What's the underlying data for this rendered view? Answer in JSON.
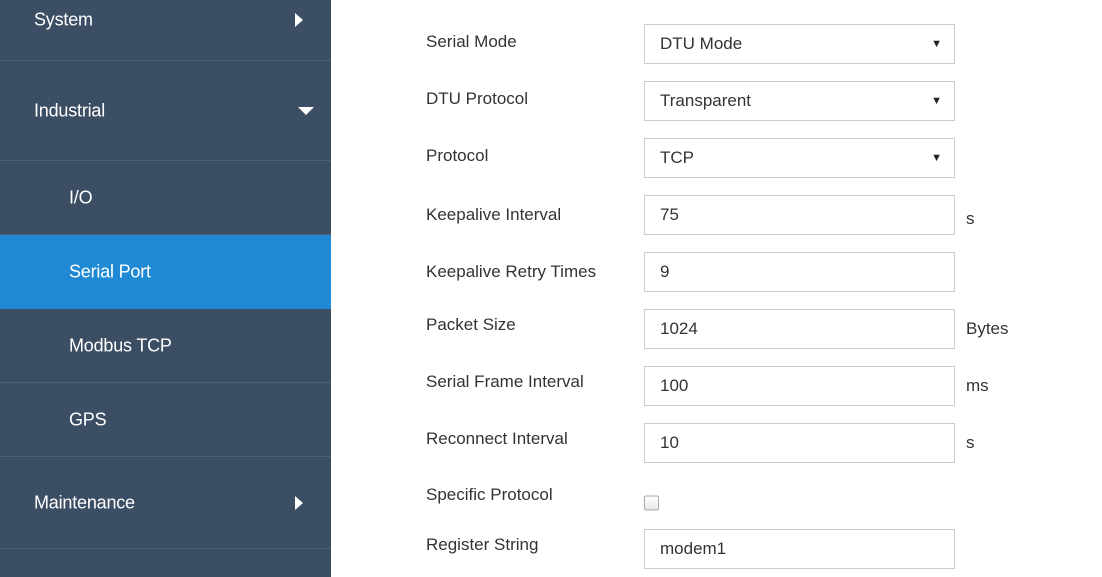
{
  "sidebar": {
    "system": "System",
    "industrial": "Industrial",
    "io": "I/O",
    "serial_port": "Serial Port",
    "modbus_tcp": "Modbus TCP",
    "gps": "GPS",
    "maintenance": "Maintenance"
  },
  "form": {
    "serial_mode": {
      "label": "Serial Mode",
      "value": "DTU Mode"
    },
    "dtu_protocol": {
      "label": "DTU Protocol",
      "value": "Transparent"
    },
    "protocol": {
      "label": "Protocol",
      "value": "TCP"
    },
    "keepalive_interval": {
      "label": "Keepalive Interval",
      "value": "75",
      "unit": "s"
    },
    "keepalive_retry_times": {
      "label": "Keepalive Retry Times",
      "value": "9"
    },
    "packet_size": {
      "label": "Packet Size",
      "value": "1024",
      "unit": "Bytes"
    },
    "serial_frame_interval": {
      "label": "Serial Frame Interval",
      "value": "100",
      "unit": "ms"
    },
    "reconnect_interval": {
      "label": "Reconnect Interval",
      "value": "10",
      "unit": "s"
    },
    "specific_protocol": {
      "label": "Specific Protocol",
      "checked": false
    },
    "register_string": {
      "label": "Register String",
      "value": "modem1"
    }
  },
  "colors": {
    "sidebar_bg": "#3c4e64",
    "active_item": "#1f8ad3",
    "field_border": "#cccccc"
  },
  "icons": {
    "dropdown": "▼"
  }
}
